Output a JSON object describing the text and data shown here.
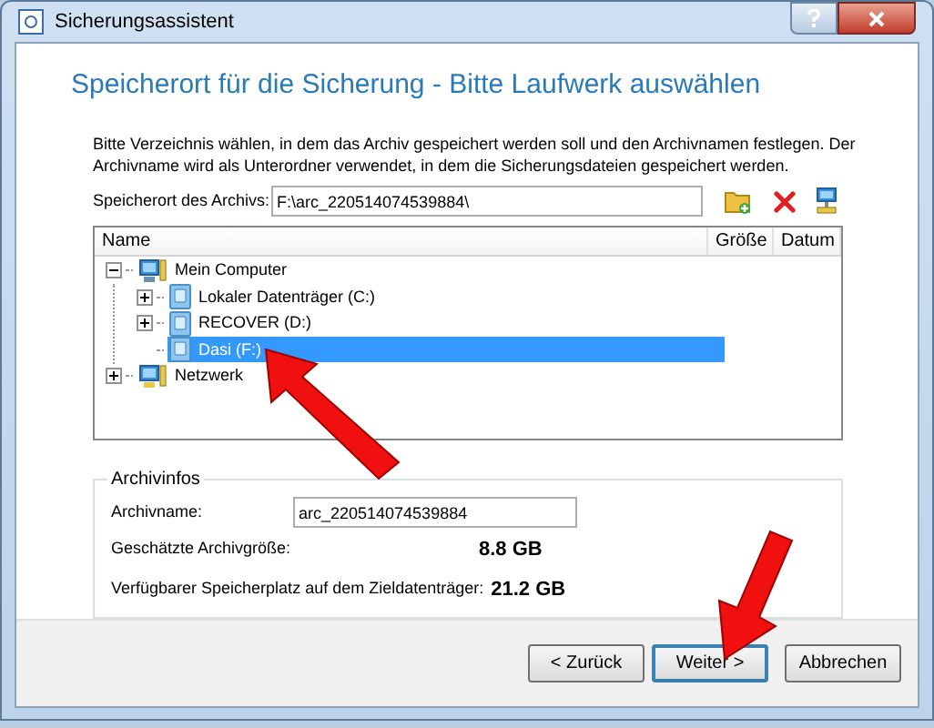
{
  "window": {
    "title": "Sicherungsassistent"
  },
  "heading": "Speicherort für die Sicherung - Bitte Laufwerk auswählen",
  "description": "Bitte Verzeichnis wählen, in dem das Archiv gespeichert werden soll und den Archivnamen festlegen. Der Archivname wird als Unterordner verwendet, in dem die Sicherungsdateien gespeichert werden.",
  "location": {
    "label": "Speicherort des Archivs:",
    "value": "F:\\arc_220514074539884\\"
  },
  "tree": {
    "columns": [
      "Name",
      "Größe",
      "Datum"
    ],
    "items": [
      {
        "kind": "computer",
        "label": "Mein Computer",
        "expanded": true,
        "selected": false,
        "children": [
          {
            "kind": "drive",
            "label": "Lokaler Datenträger (C:)",
            "expanded": false,
            "selected": false
          },
          {
            "kind": "drive",
            "label": "RECOVER (D:)",
            "expanded": false,
            "selected": false
          },
          {
            "kind": "drive",
            "label": "Dasi (F:)",
            "selected": true
          }
        ]
      },
      {
        "kind": "network",
        "label": "Netzwerk",
        "expanded": false,
        "selected": false
      }
    ]
  },
  "archive_info": {
    "title": "Archivinfos",
    "name_label": "Archivname:",
    "name_value": "arc_220514074539884",
    "rows": [
      {
        "label": "Geschätzte Archivgröße:",
        "value": "8.8 GB"
      },
      {
        "label": "Verfügbarer Speicherplatz auf dem Zieldatenträger:",
        "value": "21.2 GB"
      }
    ]
  },
  "buttons": [
    {
      "label": "< Zurück",
      "selected": false
    },
    {
      "label": "Weiter >",
      "selected": true
    },
    {
      "label": "Abbrechen",
      "selected": false
    }
  ]
}
